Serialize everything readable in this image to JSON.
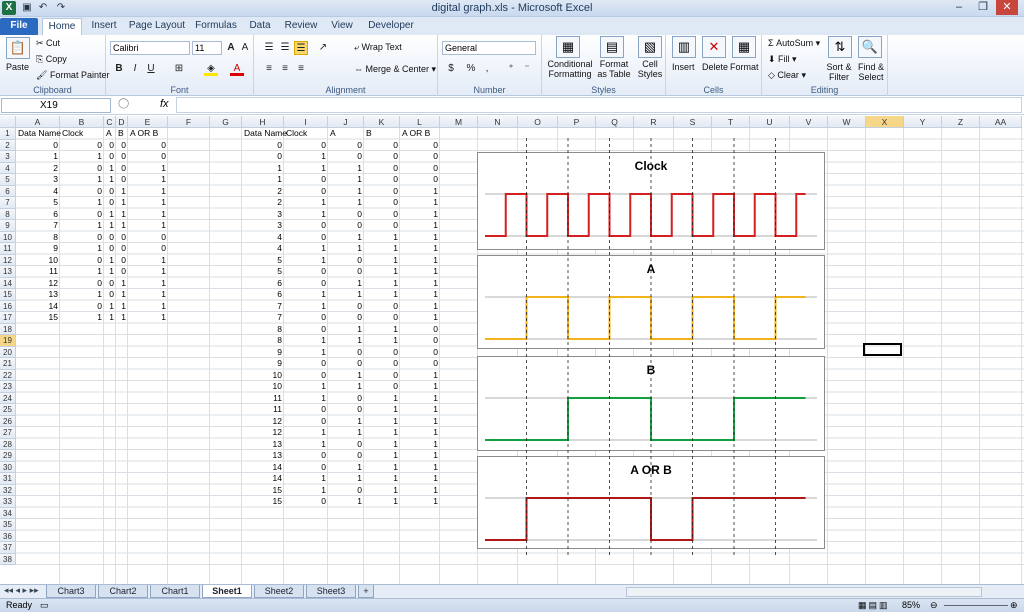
{
  "window": {
    "title": "digital graph.xls - Microsoft Excel"
  },
  "tabs": [
    "File",
    "Home",
    "Insert",
    "Page Layout",
    "Formulas",
    "Data",
    "Review",
    "View",
    "Developer"
  ],
  "ribbon": {
    "clipboard": {
      "label": "Clipboard",
      "paste": "Paste",
      "cut": "Cut",
      "copy": "Copy",
      "format_painter": "Format Painter"
    },
    "font": {
      "label": "Font",
      "name": "Calibri",
      "size": "11"
    },
    "alignment": {
      "label": "Alignment",
      "wrap": "Wrap Text",
      "merge": "Merge & Center"
    },
    "number": {
      "label": "Number",
      "format": "General"
    },
    "styles": {
      "label": "Styles",
      "cond": "Conditional Formatting",
      "table": "Format as Table",
      "cell": "Cell Styles"
    },
    "cells": {
      "label": "Cells",
      "insert": "Insert",
      "delete": "Delete",
      "format": "Format"
    },
    "editing": {
      "label": "Editing",
      "autosum": "AutoSum",
      "fill": "Fill",
      "clear": "Clear",
      "sort": "Sort & Filter",
      "find": "Find & Select"
    }
  },
  "formula_bar": {
    "name_box": "X19",
    "fx": "fx",
    "value": ""
  },
  "columns": [
    "A",
    "B",
    "C",
    "D",
    "E",
    "F",
    "G",
    "H",
    "I",
    "J",
    "K",
    "L",
    "M",
    "N",
    "O",
    "P",
    "Q",
    "R",
    "S",
    "T",
    "U",
    "V",
    "W",
    "X",
    "Y",
    "Z",
    "AA"
  ],
  "row_count": 38,
  "table1": {
    "headers": [
      "Data Name",
      "Clock",
      "A",
      "B",
      "A OR B"
    ],
    "rows": [
      [
        0,
        0,
        0,
        0,
        0
      ],
      [
        1,
        1,
        0,
        0,
        0
      ],
      [
        2,
        0,
        1,
        0,
        1
      ],
      [
        3,
        1,
        1,
        0,
        1
      ],
      [
        4,
        0,
        0,
        1,
        1
      ],
      [
        5,
        1,
        0,
        1,
        1
      ],
      [
        6,
        0,
        1,
        1,
        1
      ],
      [
        7,
        1,
        1,
        1,
        1
      ],
      [
        8,
        0,
        0,
        0,
        0
      ],
      [
        9,
        1,
        0,
        0,
        0
      ],
      [
        10,
        0,
        1,
        0,
        1
      ],
      [
        11,
        1,
        1,
        0,
        1
      ],
      [
        12,
        0,
        0,
        1,
        1
      ],
      [
        13,
        1,
        0,
        1,
        1
      ],
      [
        14,
        0,
        1,
        1,
        1
      ],
      [
        15,
        1,
        1,
        1,
        1
      ]
    ]
  },
  "table2": {
    "headers": [
      "Data Name",
      "Clock",
      "A",
      "B",
      "A OR B"
    ],
    "rows": [
      [
        0,
        0,
        0,
        0,
        0
      ],
      [
        0,
        1,
        0,
        0,
        0
      ],
      [
        1,
        1,
        1,
        0,
        0
      ],
      [
        1,
        0,
        1,
        0,
        0
      ],
      [
        2,
        0,
        1,
        0,
        1
      ],
      [
        2,
        1,
        1,
        0,
        1
      ],
      [
        3,
        1,
        0,
        0,
        1
      ],
      [
        3,
        0,
        0,
        0,
        1
      ],
      [
        4,
        0,
        1,
        1,
        1
      ],
      [
        4,
        1,
        1,
        1,
        1
      ],
      [
        5,
        1,
        0,
        1,
        1
      ],
      [
        5,
        0,
        0,
        1,
        1
      ],
      [
        6,
        0,
        1,
        1,
        1
      ],
      [
        6,
        1,
        1,
        1,
        1
      ],
      [
        7,
        1,
        0,
        0,
        1
      ],
      [
        7,
        0,
        0,
        0,
        1
      ],
      [
        8,
        0,
        1,
        1,
        0
      ],
      [
        8,
        1,
        1,
        1,
        0
      ],
      [
        9,
        1,
        0,
        0,
        0
      ],
      [
        9,
        0,
        0,
        0,
        0
      ],
      [
        10,
        0,
        1,
        0,
        1
      ],
      [
        10,
        1,
        1,
        0,
        1
      ],
      [
        11,
        1,
        0,
        1,
        1
      ],
      [
        11,
        0,
        0,
        1,
        1
      ],
      [
        12,
        0,
        1,
        1,
        1
      ],
      [
        12,
        1,
        1,
        1,
        1
      ],
      [
        13,
        1,
        0,
        1,
        1
      ],
      [
        13,
        0,
        0,
        1,
        1
      ],
      [
        14,
        0,
        1,
        1,
        1
      ],
      [
        14,
        1,
        1,
        1,
        1
      ],
      [
        15,
        1,
        0,
        1,
        1
      ],
      [
        15,
        0,
        1,
        1,
        1
      ]
    ]
  },
  "chart_data": [
    {
      "type": "line",
      "title": "Clock",
      "color": "#d42020",
      "x": [
        0,
        1,
        2,
        3,
        4,
        5,
        6,
        7,
        8,
        9,
        10,
        11,
        12,
        13,
        14,
        15
      ],
      "values": [
        0,
        1,
        0,
        1,
        0,
        1,
        0,
        1,
        0,
        1,
        0,
        1,
        0,
        1,
        0,
        1
      ]
    },
    {
      "type": "line",
      "title": "A",
      "color": "#f2b21a",
      "x": [
        0,
        1,
        2,
        3,
        4,
        5,
        6,
        7,
        8,
        9,
        10,
        11,
        12,
        13,
        14,
        15
      ],
      "values": [
        0,
        0,
        1,
        1,
        0,
        0,
        1,
        1,
        0,
        0,
        1,
        1,
        0,
        0,
        1,
        1
      ]
    },
    {
      "type": "line",
      "title": "B",
      "color": "#12a041",
      "x": [
        0,
        1,
        2,
        3,
        4,
        5,
        6,
        7,
        8,
        9,
        10,
        11,
        12,
        13,
        14,
        15
      ],
      "values": [
        0,
        0,
        0,
        0,
        1,
        1,
        1,
        1,
        0,
        0,
        0,
        0,
        1,
        1,
        1,
        1
      ]
    },
    {
      "type": "line",
      "title": "A OR B",
      "color": "#b01818",
      "x": [
        0,
        1,
        2,
        3,
        4,
        5,
        6,
        7,
        8,
        9,
        10,
        11,
        12,
        13,
        14,
        15
      ],
      "values": [
        0,
        0,
        1,
        1,
        1,
        1,
        1,
        1,
        0,
        0,
        1,
        1,
        1,
        1,
        1,
        1
      ]
    }
  ],
  "sheet_tabs": [
    "Chart3",
    "Chart2",
    "Chart1",
    "Sheet1",
    "Sheet2",
    "Sheet3"
  ],
  "active_sheet": "Sheet1",
  "status": {
    "ready": "Ready",
    "zoom": "85%"
  }
}
